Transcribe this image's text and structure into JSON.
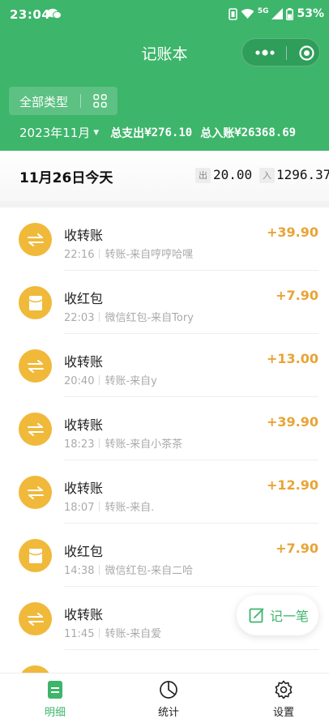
{
  "status_bar": {
    "time": "23:04",
    "network": "5G",
    "battery": "53%"
  },
  "app": {
    "title": "记账本"
  },
  "filter": {
    "type_label": "全部类型"
  },
  "summary": {
    "month": "2023年11月",
    "expense_label": "总支出",
    "expense": "¥276.10",
    "income_label": "总入账",
    "income": "¥26368.69"
  },
  "day": {
    "date": "11月26日今天",
    "out_badge": "出",
    "out": "20.00",
    "in_badge": "入",
    "in": "1296.37"
  },
  "transactions": [
    {
      "icon": "transfer-icon",
      "title": "收转账",
      "time": "22:16",
      "desc": "转账-来自哼哼哈嘿",
      "amount": "+39.90"
    },
    {
      "icon": "red-packet-icon",
      "title": "收红包",
      "time": "22:03",
      "desc": "微信红包-来自Tory",
      "amount": "+7.90"
    },
    {
      "icon": "transfer-icon",
      "title": "收转账",
      "time": "20:40",
      "desc": "转账-来自y",
      "amount": "+13.00"
    },
    {
      "icon": "transfer-icon",
      "title": "收转账",
      "time": "18:23",
      "desc": "转账-来自小茶茶",
      "amount": "+39.90"
    },
    {
      "icon": "transfer-icon",
      "title": "收转账",
      "time": "18:07",
      "desc": "转账-来自.",
      "amount": "+12.90"
    },
    {
      "icon": "red-packet-icon",
      "title": "收红包",
      "time": "14:38",
      "desc": "微信红包-来自二哈",
      "amount": "+7.90"
    },
    {
      "icon": "transfer-icon",
      "title": "收转账",
      "time": "11:45",
      "desc": "转账-来自爱",
      "amount": ""
    }
  ],
  "fab": {
    "label": "记一笔"
  },
  "tabs": [
    {
      "label": "明细",
      "icon": "detail-icon",
      "active": true
    },
    {
      "label": "统计",
      "icon": "pie-chart-icon",
      "active": false
    },
    {
      "label": "设置",
      "icon": "gear-icon",
      "active": false
    }
  ],
  "colors": {
    "brand": "#3db56b",
    "amount": "#e8a436",
    "icon_bg": "#f0b93a"
  }
}
